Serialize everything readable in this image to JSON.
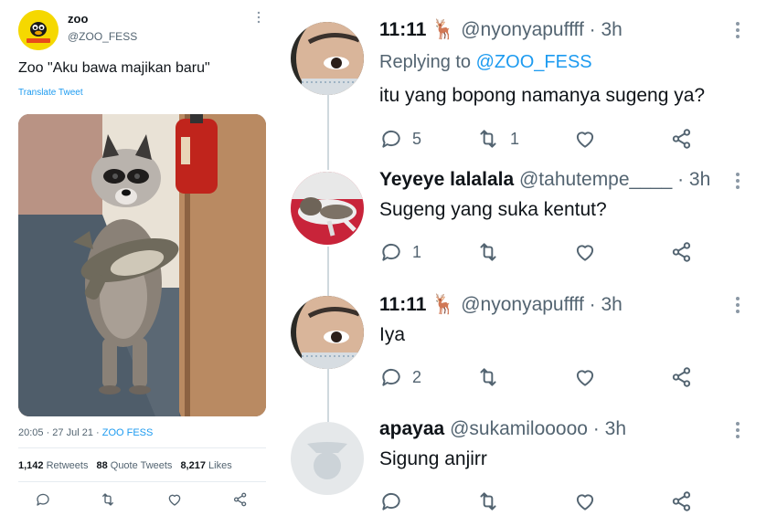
{
  "left_tweet": {
    "name": "zoo",
    "handle": "@ZOO_FESS",
    "text": "Zoo \"Aku bawa majikan baru\"",
    "translate": "Translate Tweet",
    "timestamp": "20:05 · 27 Jul 21 · ",
    "source": "ZOO FESS",
    "retweets_count": "1,142",
    "retweets_label": " Retweets",
    "quotes_count": "88",
    "quotes_label": " Quote Tweets",
    "likes_count": "8,217",
    "likes_label": " Likes",
    "more_icon": "⋮"
  },
  "replies": [
    {
      "name": "11:11 🦌",
      "handle": "@nyonyapuffff · 3h",
      "replying_prefix": "Replying to ",
      "replying_to": "@ZOO_FESS",
      "text": "itu yang bopong namanya sugeng ya?",
      "reply_count": "5",
      "retweet_count": "1",
      "like_count": ""
    },
    {
      "name": "Yeyeye lalalala",
      "handle": "@tahutempe____ · 3h",
      "text": "Sugeng yang suka kentut?",
      "reply_count": "1",
      "retweet_count": "",
      "like_count": ""
    },
    {
      "name": "11:11 🦌",
      "handle": "@nyonyapuffff · 3h",
      "text": "Iya",
      "reply_count": "2",
      "retweet_count": "",
      "like_count": ""
    },
    {
      "name": "apayaa",
      "handle": "@sukamilooooo · 3h",
      "text": "Sigung anjirr",
      "reply_count": "",
      "retweet_count": "",
      "like_count": ""
    }
  ],
  "colors": {
    "accent": "#1d9bf0",
    "secondary_text": "#536471",
    "icon": "#536471"
  }
}
